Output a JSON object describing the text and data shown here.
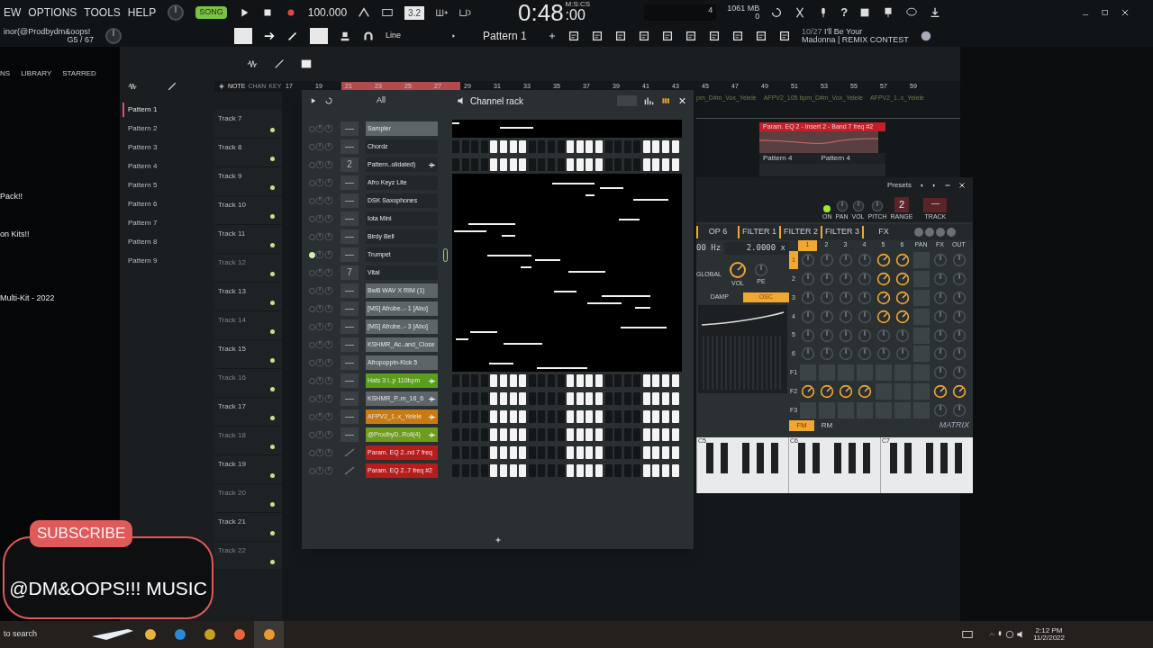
{
  "menu": [
    "EW",
    "OPTIONS",
    "TOOLS",
    "HELP"
  ],
  "hint": {
    "line1": "inor(@Prodbydm&oops!",
    "line2": "G5 / 67"
  },
  "transport": {
    "mode": "SONG",
    "tempo": "100.000",
    "countdown": "3.2",
    "time": "0:48",
    "time_small": ":00",
    "time_label": "M:S:CS",
    "cpu": "4",
    "memory": "1061 MB",
    "polyphony": "0",
    "help": "?"
  },
  "snap": "Line",
  "pattern": "Pattern 1",
  "news": {
    "date": "10/27",
    "line1": "I'll Be Your",
    "line2": "Madonna | REMIX CONTEST"
  },
  "browser": {
    "tabs": [
      "NS",
      "LIBRARY",
      "STARRED"
    ],
    "items": [
      "Pack!!",
      "on Kits!!",
      "Multi-Kit - 2022"
    ]
  },
  "playlist": {
    "toolbar": [
      "NOTE",
      "CHAN",
      "KEY"
    ],
    "patterns": [
      {
        "label": "Pattern 1",
        "selected": true
      },
      {
        "label": "Pattern 2",
        "selected": false
      },
      {
        "label": "Pattern 3",
        "selected": false
      },
      {
        "label": "Pattern 4",
        "selected": false
      },
      {
        "label": "Pattern 5",
        "selected": false
      },
      {
        "label": "Pattern 6",
        "selected": false
      },
      {
        "label": "Pattern 7",
        "selected": false
      },
      {
        "label": "Pattern 8",
        "selected": false
      },
      {
        "label": "Pattern 9",
        "selected": false
      }
    ],
    "ruler": [
      "17",
      "19",
      "21",
      "23",
      "25",
      "27",
      "29",
      "31",
      "33",
      "35",
      "37",
      "39",
      "41",
      "43",
      "45",
      "47",
      "49",
      "51",
      "53",
      "55",
      "57",
      "59"
    ],
    "tracks": [
      "Track 7",
      "Track 8",
      "Track 9",
      "Track 10",
      "Track 11",
      "Track 12",
      "Track 13",
      "Track 14",
      "Track 15",
      "Track 16",
      "Track 17",
      "Track 18",
      "Track 19",
      "Track 20",
      "Track 21",
      "Track 22"
    ],
    "clips": [
      "pm_D#m_Vox_Yelele",
      "AFPV2_105 bpm_D#m_Vox_Yelele",
      "AFPV2_1..x_Yelele"
    ],
    "automation": "Param. EQ 2 - Insert 2 - Band 7 freq #2",
    "pattern_clips": [
      "Pattern 4",
      "Pattern 4"
    ]
  },
  "channel_rack": {
    "title": "Channel rack",
    "filter": "All",
    "channels": [
      {
        "name": "Sampler",
        "kind": "notes",
        "target": "—",
        "color": "#5e6569",
        "wave": false,
        "selected": false
      },
      {
        "name": "Chordz",
        "kind": "steps",
        "target": "—",
        "color": "#22272a",
        "wave": false,
        "selected": false,
        "steps": [
          false,
          false,
          false,
          false,
          true,
          true,
          true,
          true,
          false,
          false,
          false,
          false,
          true,
          true,
          true,
          true,
          false,
          false,
          false,
          false,
          true,
          true,
          true,
          true
        ]
      },
      {
        "name": "Pattern..olidated)",
        "kind": "steps",
        "target": "2",
        "color": "#22272a",
        "wave": true,
        "selected": false,
        "steps": [
          false,
          false,
          false,
          false,
          true,
          true,
          true,
          true,
          false,
          false,
          false,
          false,
          true,
          true,
          true,
          true,
          false,
          false,
          false,
          false,
          true,
          true,
          true,
          true
        ]
      },
      {
        "name": "Afro Keyz Lite",
        "kind": "notes",
        "target": "—",
        "color": "#22272a",
        "wave": false,
        "selected": false
      },
      {
        "name": "DSK Saxophones",
        "kind": "notes",
        "target": "—",
        "color": "#22272a",
        "wave": false,
        "selected": false
      },
      {
        "name": "Iota Mini",
        "kind": "notes",
        "target": "—",
        "color": "#22272a",
        "wave": false,
        "selected": false
      },
      {
        "name": "Birdy Bell",
        "kind": "notes",
        "target": "—",
        "color": "#22272a",
        "wave": false,
        "selected": false
      },
      {
        "name": "Trumpet",
        "kind": "notes",
        "target": "—",
        "color": "#22272a",
        "wave": false,
        "selected": true
      },
      {
        "name": "Vital",
        "kind": "notes",
        "target": "7",
        "color": "#22272a",
        "wave": false,
        "selected": false
      },
      {
        "name": "BwB WAV X RIM (1)",
        "kind": "notes",
        "target": "—",
        "color": "#5e6569",
        "wave": false,
        "selected": false
      },
      {
        "name": "[MS] Afrobe..- 1 [Abo]",
        "kind": "notes",
        "target": "—",
        "color": "#5e6569",
        "wave": false,
        "selected": false
      },
      {
        "name": "[MS] Afrobe..- 3 [Abo]",
        "kind": "notes",
        "target": "—",
        "color": "#5e6569",
        "wave": false,
        "selected": false
      },
      {
        "name": "KSHMR_Ac..and_Close",
        "kind": "notes",
        "target": "—",
        "color": "#5e6569",
        "wave": false,
        "selected": false
      },
      {
        "name": "Afropoppin-Kick 5",
        "kind": "notes",
        "target": "—",
        "color": "#5e6569",
        "wave": false,
        "selected": false
      },
      {
        "name": "Hats 3 l..p 110bpm",
        "kind": "steps",
        "target": "—",
        "color": "#5c9e1c",
        "wave": true,
        "selected": false,
        "steps": [
          false,
          false,
          false,
          false,
          true,
          true,
          true,
          true,
          false,
          false,
          false,
          false,
          true,
          true,
          true,
          true,
          false,
          false,
          false,
          false,
          true,
          true,
          true,
          true
        ]
      },
      {
        "name": "KSHMR_P..m_16_6",
        "kind": "steps",
        "target": "—",
        "color": "#5e6569",
        "wave": true,
        "selected": false,
        "steps": [
          false,
          false,
          false,
          false,
          true,
          true,
          true,
          true,
          false,
          false,
          false,
          false,
          true,
          true,
          true,
          true,
          false,
          false,
          false,
          false,
          true,
          true,
          true,
          true
        ]
      },
      {
        "name": "AFPV2_1..x_Yelele",
        "kind": "steps",
        "target": "—",
        "color": "#c97b12",
        "wave": true,
        "selected": false,
        "steps": [
          false,
          false,
          false,
          false,
          true,
          true,
          true,
          true,
          false,
          false,
          false,
          false,
          true,
          true,
          true,
          true,
          false,
          false,
          false,
          false,
          true,
          true,
          true,
          true
        ]
      },
      {
        "name": "@ProdbyD..Roll(4)",
        "kind": "steps",
        "target": "—",
        "color": "#6e9c1e",
        "wave": true,
        "selected": false,
        "steps": [
          false,
          false,
          false,
          false,
          true,
          true,
          true,
          true,
          false,
          false,
          false,
          false,
          true,
          true,
          true,
          true,
          false,
          false,
          false,
          false,
          true,
          true,
          true,
          true
        ]
      },
      {
        "name": "Param. EQ 2..nd 7 freq",
        "kind": "steps",
        "color": "#b81d1d",
        "wave": false,
        "selected": false,
        "steps": [
          false,
          false,
          false,
          false,
          true,
          true,
          true,
          true,
          false,
          false,
          false,
          false,
          true,
          true,
          true,
          true,
          false,
          false,
          false,
          false,
          true,
          true,
          true,
          true
        ]
      },
      {
        "name": "Param. EQ 2..7 freq #2",
        "kind": "steps",
        "color": "#b81d1d",
        "wave": false,
        "selected": false,
        "steps": [
          false,
          false,
          false,
          false,
          true,
          true,
          true,
          true,
          false,
          false,
          false,
          false,
          true,
          true,
          true,
          true,
          false,
          false,
          false,
          false,
          true,
          true,
          true,
          true
        ]
      }
    ]
  },
  "plugin": {
    "presets": "Presets",
    "on": true,
    "header": [
      "ON",
      "PAN",
      "VOL",
      "PITCH",
      "RANGE",
      "TRACK"
    ],
    "range": "2",
    "track": "—",
    "tabs": [
      "OP 6",
      "FILTER 1",
      "FILTER 2",
      "FILTER 3",
      "FX"
    ],
    "freq": "00 Hz",
    "ratio": "2.0000 x",
    "global": "GLOBAL",
    "knobs": [
      "VOL",
      "PE"
    ],
    "modes": [
      {
        "label": "DAMP",
        "selected": false
      },
      {
        "label": "OSC",
        "selected": true
      }
    ],
    "columns": [
      {
        "label": "1",
        "selected": true
      },
      {
        "label": "2",
        "selected": false
      },
      {
        "label": "3",
        "selected": false
      },
      {
        "label": "4",
        "selected": false
      },
      {
        "label": "5",
        "selected": false
      },
      {
        "label": "6",
        "selected": false
      },
      {
        "label": "PAN",
        "selected": false
      },
      {
        "label": "FX",
        "selected": false
      },
      {
        "label": "OUT",
        "selected": false
      }
    ],
    "rows": [
      {
        "label": "1",
        "selected": true,
        "cells": [
          {
            "kind": "knob",
            "on": false
          },
          {
            "kind": "knob",
            "on": false
          },
          {
            "kind": "knob",
            "on": false
          },
          {
            "kind": "knob",
            "on": false
          },
          {
            "kind": "knob",
            "on": true
          },
          {
            "kind": "knob",
            "on": true
          },
          {
            "kind": "empty"
          },
          {
            "kind": "knob",
            "on": false
          },
          {
            "kind": "knob",
            "on": false
          }
        ]
      },
      {
        "label": "2",
        "selected": false,
        "cells": [
          {
            "kind": "knob",
            "on": false
          },
          {
            "kind": "knob",
            "on": false
          },
          {
            "kind": "knob",
            "on": false
          },
          {
            "kind": "knob",
            "on": false
          },
          {
            "kind": "knob",
            "on": true
          },
          {
            "kind": "knob",
            "on": true
          },
          {
            "kind": "empty"
          },
          {
            "kind": "knob",
            "on": false
          },
          {
            "kind": "knob",
            "on": false
          }
        ]
      },
      {
        "label": "3",
        "selected": false,
        "cells": [
          {
            "kind": "knob",
            "on": false
          },
          {
            "kind": "knob",
            "on": false
          },
          {
            "kind": "knob",
            "on": false
          },
          {
            "kind": "knob",
            "on": false
          },
          {
            "kind": "knob",
            "on": true
          },
          {
            "kind": "knob",
            "on": true
          },
          {
            "kind": "empty"
          },
          {
            "kind": "knob",
            "on": false
          },
          {
            "kind": "knob",
            "on": false
          }
        ]
      },
      {
        "label": "4",
        "selected": false,
        "cells": [
          {
            "kind": "knob",
            "on": false
          },
          {
            "kind": "knob",
            "on": false
          },
          {
            "kind": "knob",
            "on": false
          },
          {
            "kind": "knob",
            "on": false
          },
          {
            "kind": "knob",
            "on": true
          },
          {
            "kind": "knob",
            "on": true
          },
          {
            "kind": "empty"
          },
          {
            "kind": "knob",
            "on": false
          },
          {
            "kind": "knob",
            "on": false
          }
        ]
      },
      {
        "label": "5",
        "selected": false,
        "cells": [
          {
            "kind": "knob",
            "on": false
          },
          {
            "kind": "knob",
            "on": false
          },
          {
            "kind": "knob",
            "on": false
          },
          {
            "kind": "knob",
            "on": false
          },
          {
            "kind": "knob",
            "on": false
          },
          {
            "kind": "knob",
            "on": false
          },
          {
            "kind": "empty"
          },
          {
            "kind": "knob",
            "on": false
          },
          {
            "kind": "knob",
            "on": false
          }
        ]
      },
      {
        "label": "6",
        "selected": false,
        "cells": [
          {
            "kind": "knob",
            "on": false
          },
          {
            "kind": "knob",
            "on": false
          },
          {
            "kind": "knob",
            "on": false
          },
          {
            "kind": "knob",
            "on": false
          },
          {
            "kind": "knob",
            "on": false
          },
          {
            "kind": "knob",
            "on": false
          },
          {
            "kind": "empty"
          },
          {
            "kind": "knob",
            "on": false
          },
          {
            "kind": "knob",
            "on": false
          }
        ]
      },
      {
        "label": "F1",
        "selected": false,
        "cells": [
          {
            "kind": "empty"
          },
          {
            "kind": "empty"
          },
          {
            "kind": "empty"
          },
          {
            "kind": "empty"
          },
          {
            "kind": "empty"
          },
          {
            "kind": "empty"
          },
          {
            "kind": "empty"
          },
          {
            "kind": "knob",
            "on": false
          },
          {
            "kind": "knob",
            "on": false
          }
        ]
      },
      {
        "label": "F2",
        "selected": false,
        "cells": [
          {
            "kind": "knob",
            "on": true
          },
          {
            "kind": "knob",
            "on": true
          },
          {
            "kind": "knob",
            "on": true
          },
          {
            "kind": "knob",
            "on": true
          },
          {
            "kind": "empty"
          },
          {
            "kind": "empty"
          },
          {
            "kind": "empty"
          },
          {
            "kind": "knob",
            "on": true
          },
          {
            "kind": "knob",
            "on": true
          }
        ]
      },
      {
        "label": "F3",
        "selected": false,
        "cells": [
          {
            "kind": "empty"
          },
          {
            "kind": "empty"
          },
          {
            "kind": "empty"
          },
          {
            "kind": "empty"
          },
          {
            "kind": "empty"
          },
          {
            "kind": "empty"
          },
          {
            "kind": "empty"
          },
          {
            "kind": "knob",
            "on": false
          },
          {
            "kind": "knob",
            "on": false
          }
        ]
      }
    ],
    "synth_modes": [
      {
        "label": "FM",
        "selected": true
      },
      {
        "label": "RM",
        "selected": false
      }
    ],
    "matrix_label": "MATRIX",
    "octaves": [
      "C5",
      "C6",
      "C7"
    ]
  },
  "overlay": {
    "subscribe": "SUBSCRIBE",
    "channel": "@DM&OOPS!!! MUSIC"
  },
  "taskbar": {
    "search": "to search",
    "time": "2:12 PM",
    "date": "11/2/2022"
  }
}
